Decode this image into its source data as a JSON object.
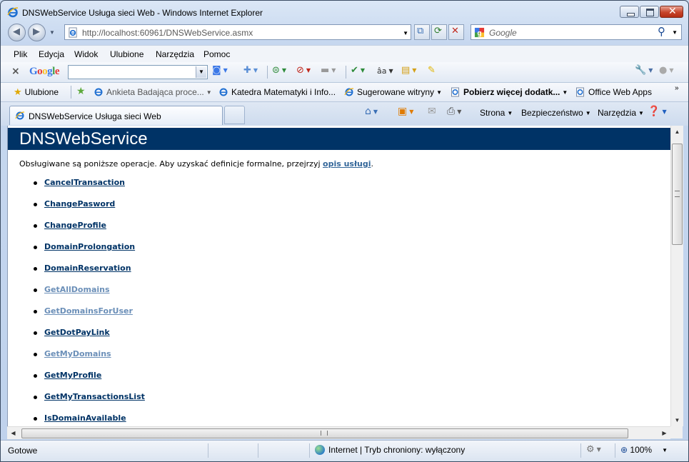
{
  "window": {
    "title": "DNSWebService Usługa sieci Web - Windows Internet Explorer"
  },
  "address": {
    "url": "http://localhost:60961/DNSWebService.asmx"
  },
  "search": {
    "placeholder": "Google"
  },
  "menu": {
    "items": [
      "Plik",
      "Edycja",
      "Widok",
      "Ulubione",
      "Narzędzia",
      "Pomoc"
    ]
  },
  "google_toolbar": {
    "logo": "Google"
  },
  "favorites": {
    "label": "Ulubione",
    "items": [
      {
        "label": "Ankieta Badająca proce..."
      },
      {
        "label": "Katedra Matematyki i Info..."
      },
      {
        "label": "Sugerowane witryny"
      },
      {
        "label": "Pobierz więcej dodatk..."
      },
      {
        "label": "Office Web Apps"
      }
    ]
  },
  "tab": {
    "label": "DNSWebService Usługa sieci Web"
  },
  "command_bar": {
    "page": "Strona",
    "safety": "Bezpieczeństwo",
    "tools": "Narzędzia"
  },
  "page": {
    "heading": "DNSWebService",
    "intro_text": "Obsługiwane są poniższe operacje. Aby uzyskać definicje formalne, przejrzyj ",
    "intro_link": "opis usługi",
    "intro_end": ".",
    "operations": [
      {
        "name": "CancelTransaction",
        "visited": false
      },
      {
        "name": "ChangePasword",
        "visited": false
      },
      {
        "name": "ChangeProfile",
        "visited": false
      },
      {
        "name": "DomainProlongation",
        "visited": false
      },
      {
        "name": "DomainReservation",
        "visited": false
      },
      {
        "name": "GetAllDomains",
        "visited": true
      },
      {
        "name": "GetDomainsForUser",
        "visited": true
      },
      {
        "name": "GetDotPayLink",
        "visited": false
      },
      {
        "name": "GetMyDomains",
        "visited": true
      },
      {
        "name": "GetMyProfile",
        "visited": false
      },
      {
        "name": "GetMyTransactionsList",
        "visited": false
      },
      {
        "name": "IsDomainAvailable",
        "visited": false
      }
    ]
  },
  "status": {
    "text": "Gotowe",
    "zone": "Internet | Tryb chroniony: wyłączony",
    "zoom": "100%"
  },
  "colors": {
    "heading_bg": "#003366",
    "link": "#003366",
    "visited_link": "#6b8fb8"
  }
}
